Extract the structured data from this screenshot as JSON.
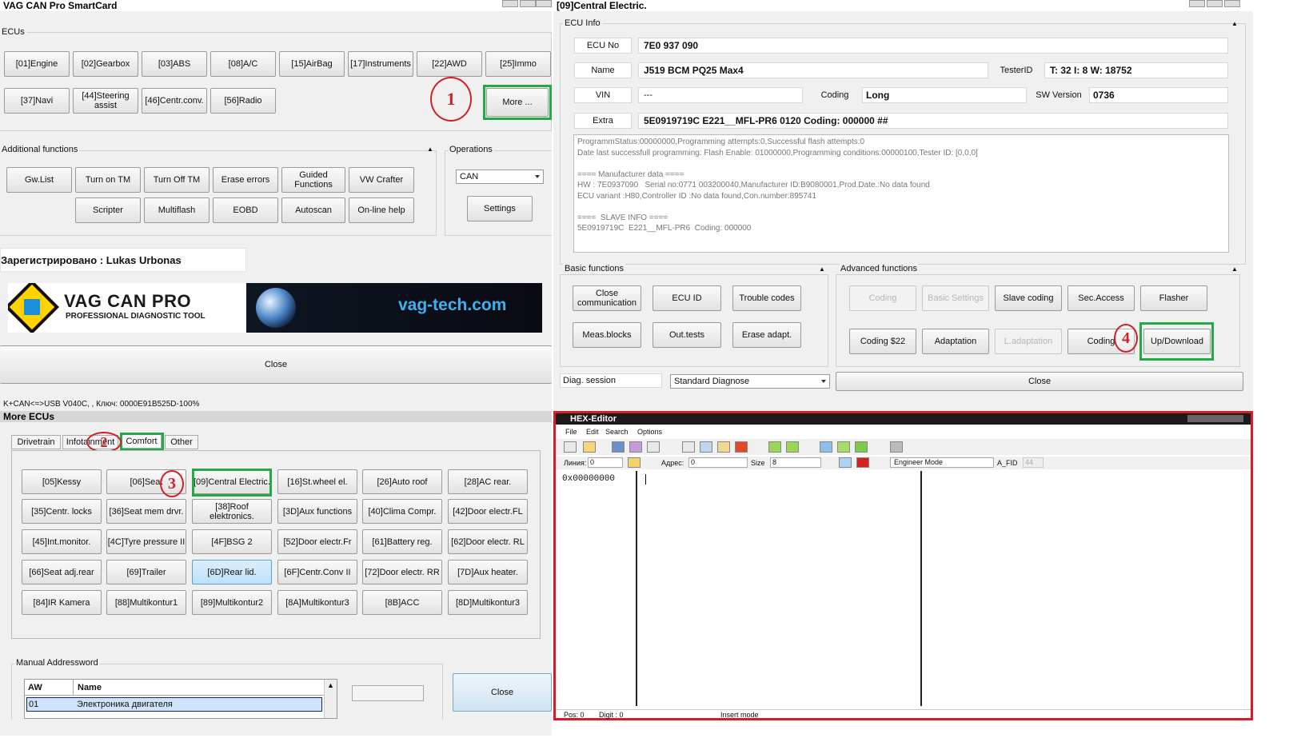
{
  "win1": {
    "title": "VAG CAN Pro SmartCard",
    "ecus_label": "ECUs",
    "ecu_buttons_row1": [
      "[01]Engine",
      "[02]Gearbox",
      "[03]ABS",
      "[08]A/C",
      "[15]AirBag",
      "[17]Instruments",
      "[22]AWD",
      "[25]Immo"
    ],
    "ecu_buttons_row2": [
      "[37]Navi",
      "[44]Steering assist",
      "[46]Centr.conv.",
      "[56]Radio"
    ],
    "more_button": "More ...",
    "additional_label": "Additional functions",
    "additional_row1": [
      "Gw.List",
      "Turn on TM",
      "Turn Off TM",
      "Erase errors",
      "Guided Functions",
      "VW Crafter"
    ],
    "additional_row2": [
      "Scripter",
      "Multiflash",
      "EOBD",
      "Autoscan",
      "On-line help"
    ],
    "operations_label": "Operations",
    "operations_select": "CAN",
    "settings_button": "Settings",
    "registered": "Зарегистрировано : Lukas Urbonas",
    "logo": {
      "brand": "VAG CAN PRO",
      "tagline": "PROFESSIONAL DIAGNOSTIC TOOL",
      "site": "vag-tech.com"
    },
    "close_button": "Close",
    "status": "K+CAN<=>USB V040C, , Ключ: 0000E91B525D-100%"
  },
  "win2": {
    "title": "[09]Central Electric.",
    "ecu_info_label": "ECU Info",
    "ecu_no_label": "ECU No",
    "ecu_no": "7E0 937 090",
    "name_label": "Name",
    "name": "J519 BCM PQ25 Max4",
    "tester_label": "TesterID",
    "tester": "T: 32 I: 8 W: 18752",
    "vin_label": "VIN",
    "vin": "---",
    "coding_label": "Coding",
    "coding": "Long",
    "sw_label": "SW Version",
    "sw": "0736",
    "extra_label": "Extra",
    "extra": "5E0919719C  E221__MFL-PR6 0120 Coding: 000000 ##",
    "info_text": "ProgrammStatus:00000000,Programming attempts:0,Successful flash attempts:0\nDate last successfull programming: Flash Enable: 01000000,Programming conditions:00000100,Tester ID: [0,0,0]\n\n==== Manufacturer data ====\nHW : 7E0937090   Serial no:0771 003200040,Manufacturer ID:B9080001,Prod.Date.:No data found\nECU variant :H80,Controller ID :No data found,Con.number:895741\n\n====  SLAVE INFO ====\n5E0919719C  E221__MFL-PR6  Coding: 000000",
    "basic_label": "Basic functions",
    "basic_buttons": [
      "Close communication",
      "ECU ID",
      "Trouble codes",
      "Meas.blocks",
      "Out.tests",
      "Erase adapt."
    ],
    "advanced_label": "Advanced functions",
    "advanced_row1": [
      "Coding",
      "Basic Settings",
      "Slave coding",
      "Sec.Access",
      "Flasher"
    ],
    "advanced_row2": [
      "Coding $22",
      "Adaptation",
      "L.adaptation",
      "Coding",
      "Up/Download"
    ],
    "diag_label": "Diag. session",
    "diag_select": "Standard Diagnose",
    "close_button": "Close"
  },
  "win3": {
    "title": "More ECUs",
    "tabs": [
      "Drivetrain",
      "Infotainment",
      "Comfort",
      "Other"
    ],
    "ecu_grid": [
      [
        "[05]Kessy",
        "[06]Seat",
        "[09]Central Electric.",
        "[16]St.wheel el.",
        "[26]Auto roof",
        "[28]AC rear."
      ],
      [
        "[35]Centr. locks",
        "[36]Seat mem drvr.",
        "[38]Roof elektronics.",
        "[3D]Aux functions",
        "[40]Clima Compr.",
        "[42]Door electr.FL"
      ],
      [
        "[45]Int.monitor.",
        "[4C]Tyre pressure II",
        "[4F]BSG 2",
        "[52]Door electr.Fr",
        "[61]Battery reg.",
        "[62]Door electr. RL"
      ],
      [
        "[66]Seat adj.rear",
        "[69]Trailer",
        "[6D]Rear lid.",
        "[6F]Centr.Conv II",
        "[72]Door electr. RR",
        "[7D]Aux heater."
      ],
      [
        "[84]IR Kamera",
        "[88]Multikontur1",
        "[89]Multikontur2",
        "[8A]Multikontur3",
        "[8B]ACC",
        "[8D]Multikontur3"
      ]
    ],
    "manual_label": "Manual Addressword",
    "col_aw": "AW",
    "col_name": "Name",
    "row_aw": "01",
    "row_name": "Электроника двигателя",
    "close_button": "Close"
  },
  "win4": {
    "title": "HEX-Editor",
    "menu": [
      "File",
      "Edit",
      "Search",
      "Options"
    ],
    "line_label": "Линия:",
    "line_value": "0",
    "addr_label": "Адрес:",
    "addr_value": "0",
    "size_label": "Size",
    "size_value": "8",
    "mode_select": "Engineer Mode",
    "fid_label": "A_FID",
    "fid_value": "44",
    "offset": "0x00000000",
    "status_pos": "Pos: 0",
    "status_digit": "Digit : 0",
    "status_mode": "Insert mode"
  },
  "annotations": [
    "1",
    "2",
    "3",
    "4"
  ]
}
